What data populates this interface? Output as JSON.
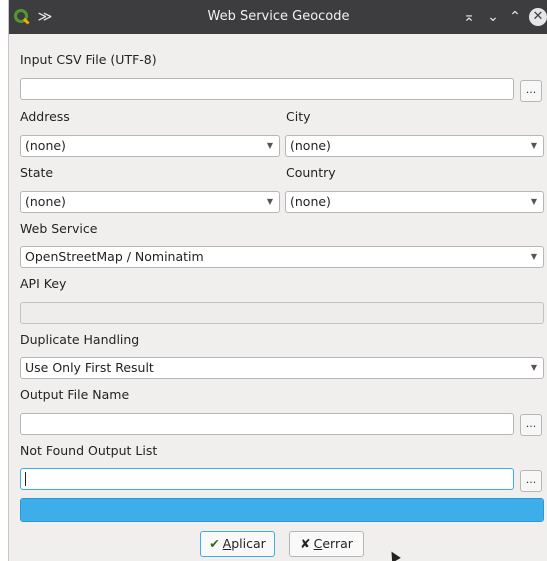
{
  "window": {
    "title": "Web Service Geocode",
    "keep_above_glyph": "≫",
    "minimize_glyph": "⌅",
    "shade_glyph": "⌄",
    "maximize_glyph": "⌃",
    "close_glyph": "✕"
  },
  "form": {
    "input_csv_label": "Input CSV File (UTF-8)",
    "input_csv_value": "",
    "address_label": "Address",
    "address_value": "(none)",
    "city_label": "City",
    "city_value": "(none)",
    "state_label": "State",
    "state_value": "(none)",
    "country_label": "Country",
    "country_value": "(none)",
    "web_service_label": "Web Service",
    "web_service_value": "OpenStreetMap / Nominatim",
    "api_key_label": "API Key",
    "api_key_value": "",
    "duplicate_label": "Duplicate Handling",
    "duplicate_value": "Use Only First Result",
    "output_file_label": "Output File Name",
    "output_file_value": "",
    "not_found_label": "Not Found Output List",
    "not_found_value": "",
    "browse_label": "...",
    "combo_arrow": "▼"
  },
  "progress": {
    "fraction": 1.0
  },
  "buttons": {
    "apply_icon": "✔",
    "apply_mnemonic": "A",
    "apply_rest": "plicar",
    "close_icon": "✘",
    "close_mnemonic": "C",
    "close_rest": "errar"
  },
  "colors": {
    "accent": "#3daee9",
    "titlebar": "#3d3d3f",
    "qgis_green": "#589632"
  }
}
